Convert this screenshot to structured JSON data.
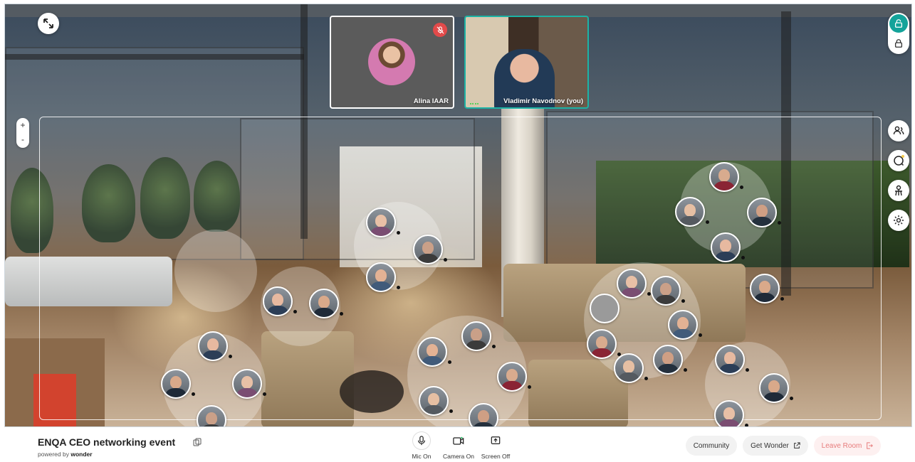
{
  "room": {
    "event_title": "ENQA CEO networking event",
    "powered_by_prefix": "powered by",
    "powered_by_brand": "wonder"
  },
  "videos": [
    {
      "name": "Alina IAAR",
      "muted": true
    },
    {
      "name": "Vladimir Navodnov (you)",
      "muted": false,
      "active": true
    }
  ],
  "zoom": {
    "plus": "+",
    "minus": "-"
  },
  "controls": [
    {
      "label": "Mic On",
      "icon": "microphone-icon"
    },
    {
      "label": "Camera On",
      "icon": "camera-icon"
    },
    {
      "label": "Screen Off",
      "icon": "screen-share-icon"
    }
  ],
  "actions": {
    "community": "Community",
    "get_wonder": "Get Wonder",
    "leave_room": "Leave Room"
  },
  "side_tools": [
    "people-icon",
    "chat-icon",
    "broadcast-icon",
    "settings-icon"
  ],
  "colors": {
    "accent": "#1cb3a5",
    "leave": "#e77b7b",
    "muted": "#e24a4a"
  }
}
